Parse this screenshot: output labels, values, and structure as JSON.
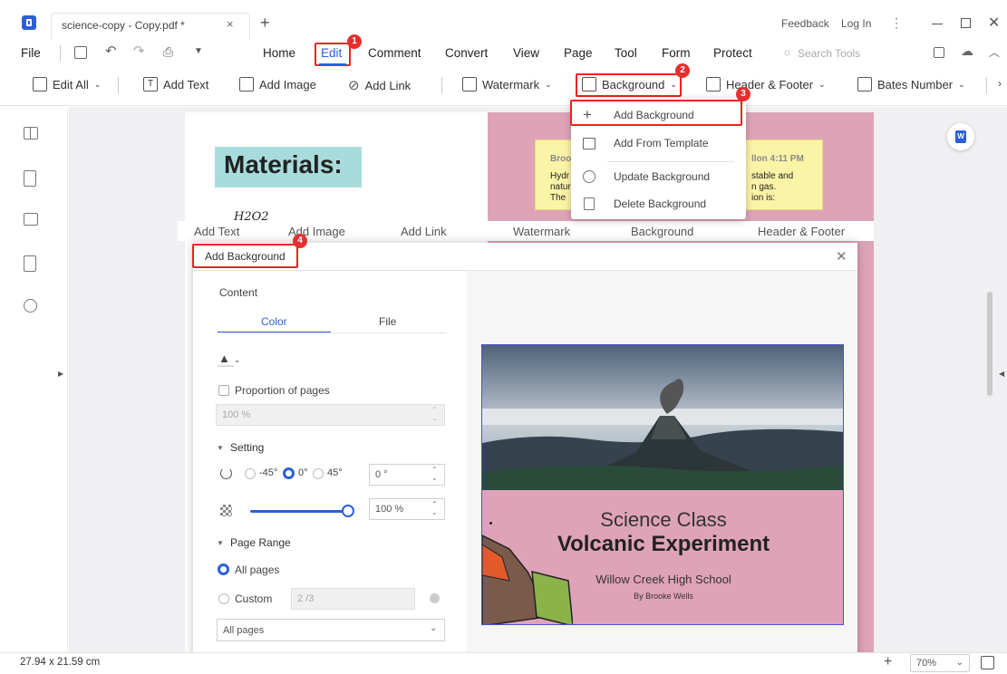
{
  "window": {
    "tab_title": "science-copy - Copy.pdf *",
    "feedback": "Feedback",
    "login": "Log In"
  },
  "menu": {
    "file": "File",
    "items": [
      "Home",
      "Edit",
      "Comment",
      "Convert",
      "View",
      "Page",
      "Tool",
      "Form",
      "Protect"
    ],
    "search_placeholder": "Search Tools"
  },
  "toolbar": {
    "edit_all": "Edit All",
    "add_text": "Add Text",
    "add_image": "Add Image",
    "add_link": "Add Link",
    "watermark": "Watermark",
    "background": "Background",
    "header_footer": "Header & Footer",
    "bates_number": "Bates Number"
  },
  "badges": [
    "1",
    "2",
    "3",
    "4"
  ],
  "dropdown": {
    "items": [
      "Add Background",
      "Add From Template",
      "Update Background",
      "Delete Background"
    ]
  },
  "document": {
    "heading": "Materials:",
    "handwriting": "H2O2",
    "note_lines": [
      "Broo",
      "Hydr",
      "natur",
      "The"
    ],
    "note_right": [
      "llon 4:11 PM",
      "stable and",
      "n gas.",
      "ion is:"
    ],
    "ghost_toolbar": [
      "Add Text",
      "Add Image",
      "Add Link",
      "Watermark",
      "Background",
      "Header & Footer"
    ]
  },
  "dialog": {
    "title": "Add Background",
    "content_label": "Content",
    "tabs": [
      "Color",
      "File"
    ],
    "proportion_label": "Proportion of pages",
    "proportion_value": "100 %",
    "setting_label": "Setting",
    "rotation_options": [
      "-45°",
      "0°",
      "45°"
    ],
    "rotation_value": "0 °",
    "opacity_value": "100 %",
    "page_range_label": "Page Range",
    "all_pages": "All pages",
    "custom": "Custom",
    "custom_value": "2 /3",
    "pages_select": "All pages"
  },
  "preview": {
    "title_line1": "Science Class",
    "title_line2": "Volcanic Experiment",
    "school": "Willow Creek High School",
    "author": "By Brooke Wells"
  },
  "status": {
    "page_size": "27.94 x 21.59 cm",
    "zoom": "70%"
  },
  "colors": {
    "accent_blue": "#2c5fd8",
    "highlight_red": "#e22222",
    "pink_page": "#dfa3b7",
    "teal_heading": "#a8dcdc",
    "note_yellow": "#fbf3a6"
  }
}
